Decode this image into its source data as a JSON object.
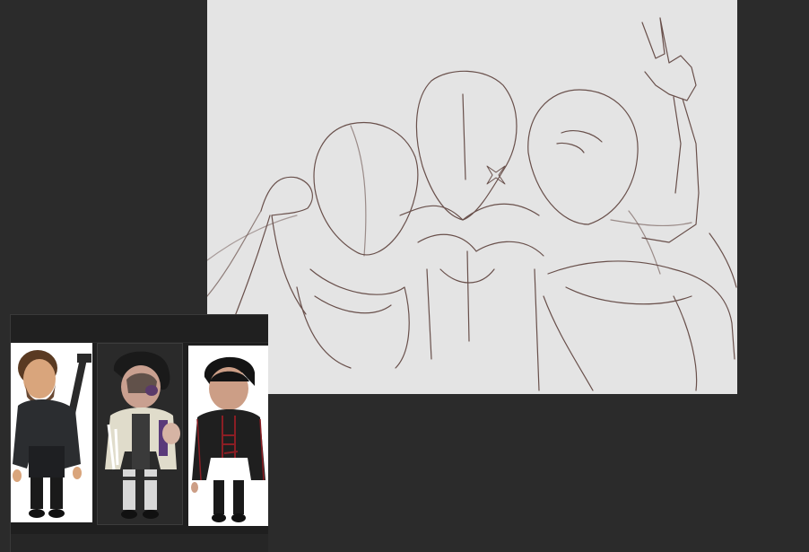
{
  "app": {
    "background_color": "#2b2b2b"
  },
  "canvas": {
    "paper_color": "#e4e4e4",
    "stroke_color": "#5a3f3a",
    "content": "sketch-three-figures-group"
  },
  "reference_panel": {
    "background_color": "#1f1f1f",
    "images": [
      {
        "name": "bearded-character-with-rifle"
      },
      {
        "name": "scarred-character-in-robe"
      },
      {
        "name": "young-character-in-black-coat"
      }
    ]
  }
}
